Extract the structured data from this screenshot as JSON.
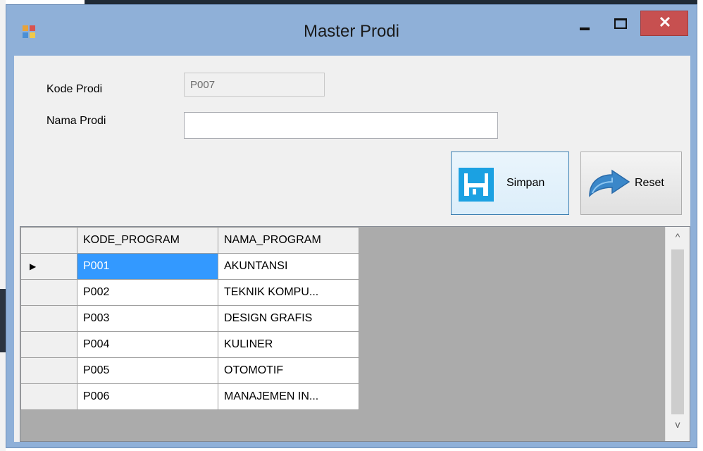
{
  "window": {
    "title": "Master Prodi",
    "icons": {
      "app": "app-icon",
      "minimize": "minimize-icon",
      "maximize": "maximize-icon",
      "close": "close-icon"
    },
    "close_glyph": "✕"
  },
  "form": {
    "kode_label": "Kode Prodi",
    "kode_value": "P007",
    "nama_label": "Nama Prodi",
    "nama_value": ""
  },
  "buttons": {
    "simpan_label": "Simpan",
    "simpan_icon": "floppy-disk-icon",
    "reset_label": "Reset",
    "reset_icon": "undo-arrow-icon"
  },
  "grid": {
    "columns": [
      "KODE_PROGRAM",
      "NAMA_PROGRAM"
    ],
    "rows": [
      {
        "kode": "P001",
        "nama": "AKUNTANSI",
        "current": true
      },
      {
        "kode": "P002",
        "nama": "TEKNIK KOMPU..."
      },
      {
        "kode": "P003",
        "nama": "DESIGN GRAFIS"
      },
      {
        "kode": "P004",
        "nama": "KULINER"
      },
      {
        "kode": "P005",
        "nama": "OTOMOTIF"
      },
      {
        "kode": "P006",
        "nama": "MANAJEMEN IN..."
      }
    ],
    "current_row_glyph": "▶",
    "scroll_up_glyph": "^",
    "scroll_down_glyph": "v"
  },
  "colors": {
    "title_bar": "#8fb0d8",
    "close_button": "#c75050",
    "selection": "#3399ff",
    "floppy_icon": "#1ba1e2"
  }
}
